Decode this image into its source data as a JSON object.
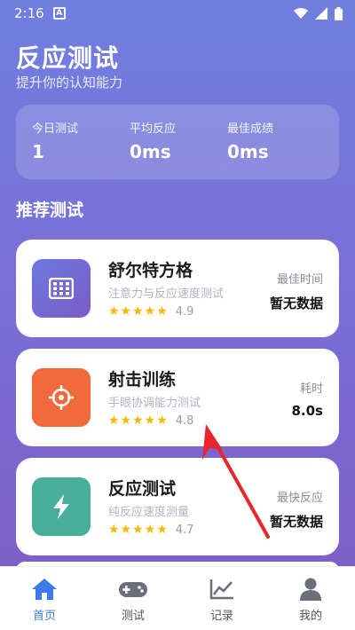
{
  "status_bar": {
    "time": "2:16",
    "notification_letter": "A"
  },
  "header": {
    "title": "反应测试",
    "subtitle": "提升你的认知能力"
  },
  "stats": [
    {
      "label": "今日测试",
      "value": "1"
    },
    {
      "label": "平均反应",
      "value": "0ms"
    },
    {
      "label": "最佳成绩",
      "value": "0ms"
    }
  ],
  "section_title": "推荐测试",
  "cards": [
    {
      "name": "舒尔特方格",
      "desc": "注意力与反应速度测试",
      "stars": "★★★★★",
      "score": "4.9",
      "metric_label": "最佳时间",
      "metric_value": "暂无数据",
      "icon": "grid-icon",
      "color": "#6f66d8"
    },
    {
      "name": "射击训练",
      "desc": "手眼协调能力测试",
      "stars": "★★★★★",
      "score": "4.8",
      "metric_label": "耗时",
      "metric_value": "8.0s",
      "icon": "crosshair-icon",
      "color": "#f06a3b"
    },
    {
      "name": "反应测试",
      "desc": "纯反应速度测量",
      "stars": "★★★★★",
      "score": "4.7",
      "metric_label": "最快反应",
      "metric_value": "暂无数据",
      "icon": "lightning-icon",
      "color": "#49ad9b"
    }
  ],
  "bottom_nav": [
    {
      "label": "首页",
      "icon": "home-icon",
      "active": true
    },
    {
      "label": "测试",
      "icon": "gamepad-icon",
      "active": false
    },
    {
      "label": "记录",
      "icon": "chart-icon",
      "active": false
    },
    {
      "label": "我的",
      "icon": "person-icon",
      "active": false
    }
  ],
  "colors": {
    "accent": "#3d7be8",
    "star": "#f5b800",
    "annotation": "#e8262b"
  }
}
